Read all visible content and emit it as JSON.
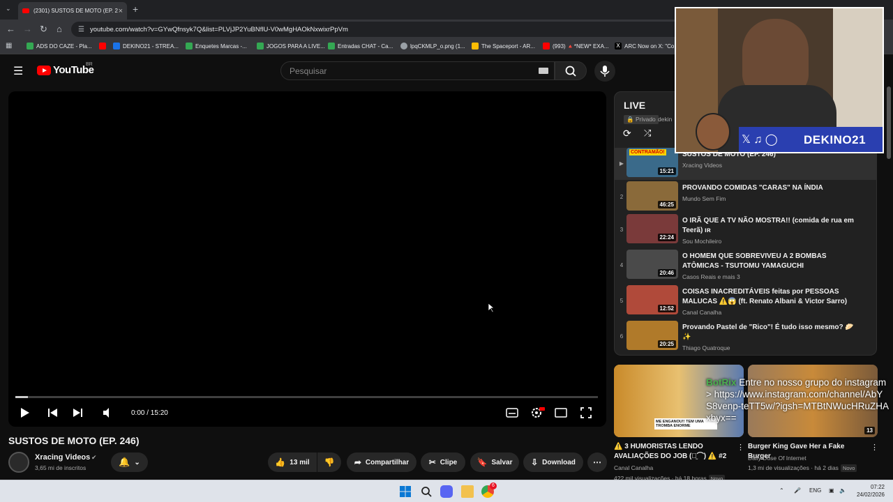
{
  "browser": {
    "tab_title": "(2301) SUSTOS DE MOTO (EP. 2",
    "url": "youtube.com/watch?v=GYwQfnsyk7Q&list=PLVjJP2YuBNflU-V0wMgHAOkNxwixrPpVm",
    "bookmarks": [
      {
        "label": "ADS DO CAZE - Pla...",
        "color": "#34a853"
      },
      {
        "label": "DEKINO21 - STREA...",
        "color": "#1a73e8"
      },
      {
        "label": "Enquetes Marcas -...",
        "color": "#34a853"
      },
      {
        "label": "JOGOS PARA A LIVE...",
        "color": "#34a853"
      },
      {
        "label": "Entradas CHAT - Ca...",
        "color": "#34a853"
      },
      {
        "label": "lpqCKMLP_o.png (1...",
        "color": "#9aa0a6"
      },
      {
        "label": "The Spaceport - AR...",
        "color": "#fbbc04"
      },
      {
        "label": "(993) 🔺*NEW* EXA...",
        "color": "#ff0000"
      },
      {
        "label": "ARC Now on X: \"Co...",
        "color": "#000000"
      }
    ]
  },
  "youtube": {
    "logo_text": "YouTube",
    "region": "BR",
    "search_placeholder": "Pesquisar"
  },
  "player": {
    "time": "0:00 / 15:20",
    "progress_fraction": 0.0
  },
  "video": {
    "title": "SUSTOS DE MOTO (EP. 246)",
    "channel": "Xracing Videos",
    "subscribers": "3,65 mi de inscritos",
    "likes": "13 mil",
    "share": "Compartilhar",
    "clip": "Clipe",
    "save": "Salvar",
    "download": "Download"
  },
  "playlist": {
    "header": "LIVE",
    "privacy": "Privado",
    "owner": "dekin",
    "items": [
      {
        "idx": "▶",
        "title": "SUSTOS DE MOTO (EP. 246)",
        "channel": "Xracing Videos",
        "duration": "15:21",
        "thumb": "#3a6a8a"
      },
      {
        "idx": "2",
        "title": "PROVANDO COMIDAS \"CARAS\" NA ÍNDIA",
        "channel": "Mundo Sem Fim",
        "duration": "46:25",
        "thumb": "#8a6a3a"
      },
      {
        "idx": "3",
        "title": "O IRÃ QUE A TV NÃO MOSTRA!! (comida de rua em Teerã) ıʀ",
        "channel": "Sou Mochileiro",
        "duration": "22:24",
        "thumb": "#7a3a3a"
      },
      {
        "idx": "4",
        "title": "O HOMEM QUE SOBREVIVEU A 2 BOMBAS ATÔMICAS - TSUTOMU YAMAGUCHI",
        "channel": "Casos Reais e mais 3",
        "duration": "20:46",
        "thumb": "#4a4a4a"
      },
      {
        "idx": "5",
        "title": "COISAS INACREDITÁVEIS feitas por PESSOAS MALUCAS ⚠️😱 (ft. Renato Albani & Victor Sarro)",
        "channel": "Canal Canalha",
        "duration": "12:52",
        "thumb": "#b04a3a"
      },
      {
        "idx": "6",
        "title": "Provando Pastel de \"Rico\"! É tudo isso mesmo? 🥟✨",
        "channel": "Thiago Quatroque",
        "duration": "20:25",
        "thumb": "#b07a2a"
      }
    ]
  },
  "overlay": {
    "brand": "DEKINO21",
    "chat_user": "BotRix",
    "chat_message": "Entre no nosso grupo do instagram > https://www.instagram.com/channel/AbYS8venp-teTT5w/?igsh=MTBtNWucHRuZHAxbyx=="
  },
  "recommended": [
    {
      "title": "⚠️ 3 HUMORISTAS LENDO AVALIAÇÕES DO JOB (⌒̫⌒) ⚠️ #2",
      "channel": "Canal Canalha",
      "meta": "422 mil visualizações · há 18 horas",
      "badge": "Novo",
      "thumb_caption": "ME ENGANOU!! TEM UMA TROMBA ENORME"
    },
    {
      "title": "Burger King Gave Her a Fake Burger",
      "channel": "Daily Dose Of Internet",
      "meta": "1,3 mi de visualizações · há 2 dias",
      "badge": "Novo",
      "duration": "13"
    }
  ],
  "taskbar": {
    "lang": "ENG",
    "time": "07:22",
    "date": "24/02/2026",
    "notif": "6"
  }
}
